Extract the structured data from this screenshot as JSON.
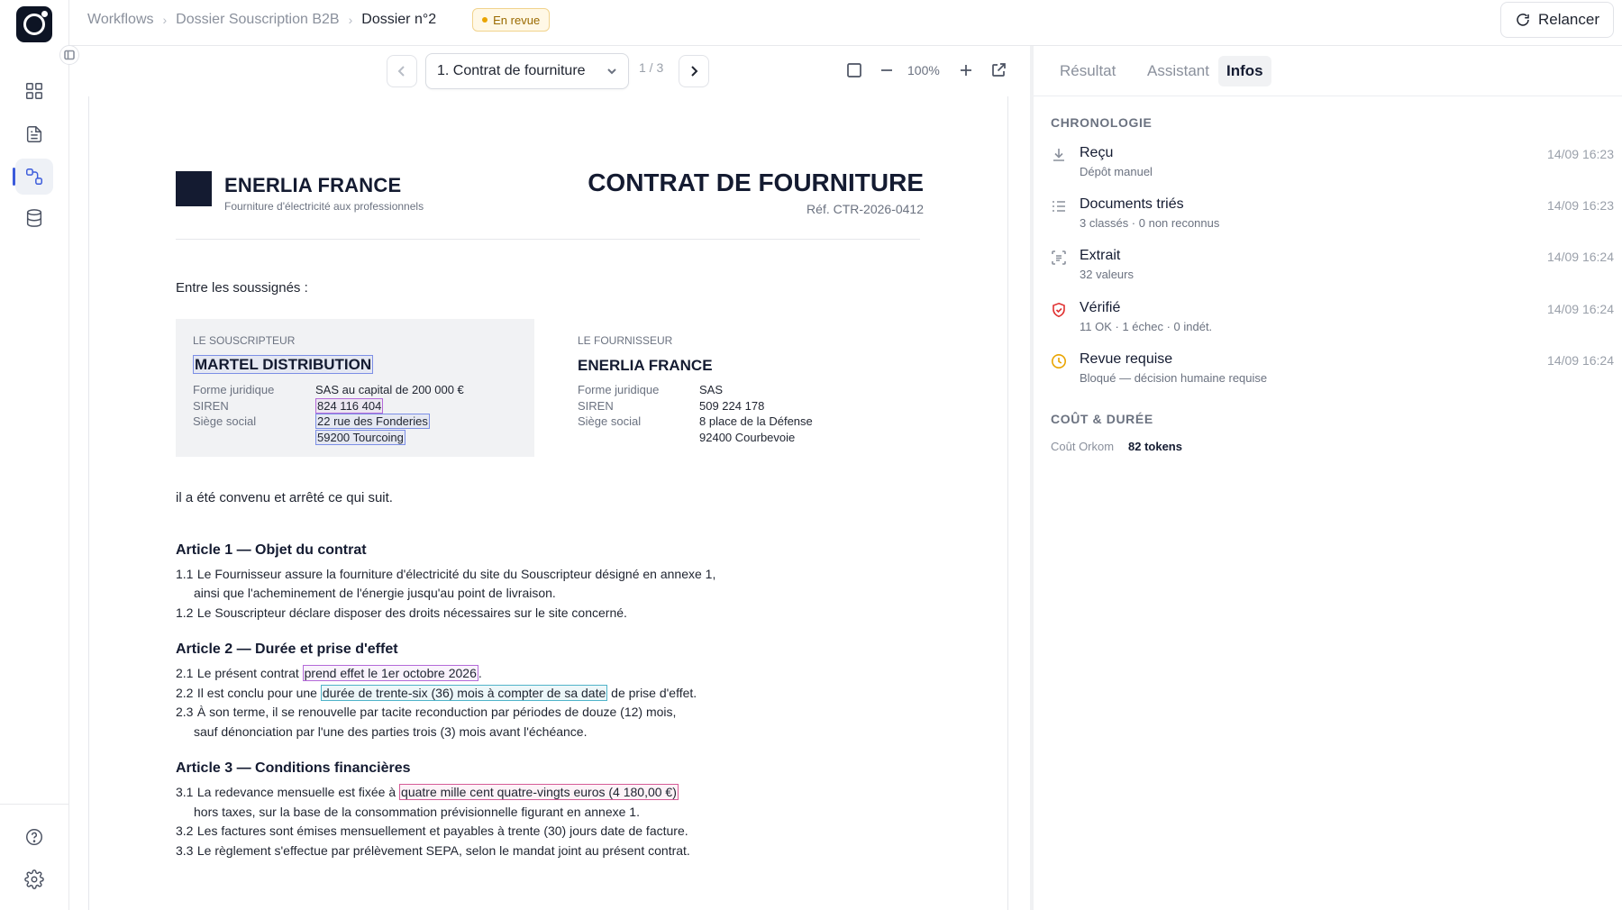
{
  "breadcrumb": {
    "items": [
      "Workflows",
      "Dossier Souscription B2B",
      "Dossier n°2"
    ],
    "status_badge": "En revue"
  },
  "header": {
    "relaunch_label": "Relancer"
  },
  "viewer": {
    "document_select": "1. Contrat de fourniture",
    "pager": "1 / 3",
    "zoom": "100%"
  },
  "document": {
    "brand_name": "ENERLIA FRANCE",
    "brand_tagline": "Fourniture d'électricité aux professionnels",
    "title": "CONTRAT DE FOURNITURE",
    "reference": "Réf. CTR-2026-0412",
    "intro": "Entre les soussignés :",
    "subscriber": {
      "label": "LE SOUSCRIPTEUR",
      "name": "MARTEL DISTRIBUTION",
      "legal_form_label": "Forme juridique",
      "legal_form": "SAS au capital de 200 000 €",
      "siren_label": "SIREN",
      "siren": "824 116 404",
      "hq_label": "Siège social",
      "hq_line1": "22 rue des Fonderies",
      "hq_line2": "59200 Tourcoing"
    },
    "supplier": {
      "label": "LE FOURNISSEUR",
      "name": "ENERLIA FRANCE",
      "legal_form_label": "Forme juridique",
      "legal_form": "SAS",
      "siren_label": "SIREN",
      "siren": "509 224 178",
      "hq_label": "Siège social",
      "hq_line1": "8 place de la Défense",
      "hq_line2": "92400 Courbevoie"
    },
    "agreed": "il a été convenu et arrêté ce qui suit.",
    "article1": {
      "title": "Article 1 — Objet du contrat",
      "c1_num": "1.1",
      "c1_text": "Le Fournisseur assure la fourniture d'électricité du site du Souscripteur désigné en annexe 1,",
      "c1_cont": "ainsi que l'acheminement de l'énergie jusqu'au point de livraison.",
      "c2_num": "1.2",
      "c2_text": "Le Souscripteur déclare disposer des droits nécessaires sur le site concerné."
    },
    "article2": {
      "title": "Article 2 — Durée et prise d'effet",
      "c1_num": "2.1",
      "c1_pre": "Le présent contrat ",
      "c1_hl": "prend effet le 1er octobre 2026",
      "c1_post": ".",
      "c2_num": "2.2",
      "c2_pre": "Il est conclu pour une ",
      "c2_hl": "durée de trente-six (36) mois à compter de sa date",
      "c2_post": " de prise d'effet.",
      "c3_num": "2.3",
      "c3_text": "À son terme, il se renouvelle par tacite reconduction par périodes de douze (12) mois,",
      "c3_cont": "sauf dénonciation par l'une des parties trois (3) mois avant l'échéance."
    },
    "article3": {
      "title": "Article 3 — Conditions financières",
      "c1_num": "3.1",
      "c1_pre": "La redevance mensuelle est fixée à ",
      "c1_hl": "quatre mille cent quatre-vingts euros (4 180,00 €)",
      "c1_cont": "hors taxes, sur la base de la consommation prévisionnelle figurant en annexe 1.",
      "c2_num": "3.2",
      "c2_text": "Les factures sont émises mensuellement et payables à trente (30) jours date de facture.",
      "c3_num": "3.3",
      "c3_text": "Le règlement s'effectue par prélèvement SEPA, selon le mandat joint au présent contrat."
    }
  },
  "panel": {
    "tabs": [
      "Résultat",
      "Assistant",
      "Infos"
    ],
    "active_tab": "Infos",
    "timeline_heading": "CHRONOLOGIE",
    "events": [
      {
        "title": "Reçu",
        "sub": "Dépôt manuel",
        "time": "14/09 16:23",
        "icon": "download-icon"
      },
      {
        "title": "Documents triés",
        "sub": "3 classés · 0 non reconnus",
        "time": "14/09 16:23",
        "icon": "list-sort-icon"
      },
      {
        "title": "Extrait",
        "sub": "32 valeurs",
        "time": "14/09 16:24",
        "icon": "scan-text-icon"
      },
      {
        "title": "Vérifié",
        "sub": "11 OK · 1 échec · 0 indét.",
        "time": "14/09 16:24",
        "icon": "shield-alert-icon"
      },
      {
        "title": "Revue requise",
        "sub": "Bloqué — décision humaine requise",
        "time": "14/09 16:24",
        "icon": "clock-icon"
      }
    ],
    "cost_heading": "COÛT & DURÉE",
    "cost_label": "Coût Orkom",
    "cost_value": "82 tokens"
  },
  "colors": {
    "accent": "#3b5bdb",
    "warning": "#e9a400",
    "danger": "#e03131",
    "brand_dark": "#141b31"
  }
}
